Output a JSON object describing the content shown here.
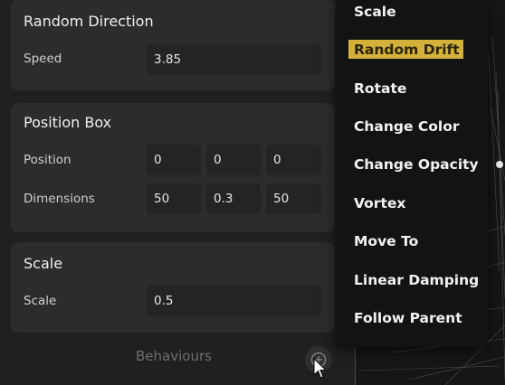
{
  "cards": {
    "random_direction": {
      "title": "Random Direction",
      "speed_label": "Speed",
      "speed_value": "3.85"
    },
    "position_box": {
      "title": "Position Box",
      "position_label": "Position",
      "position_values": [
        "0",
        "0",
        "0"
      ],
      "dimensions_label": "Dimensions",
      "dimensions_values": [
        "50",
        "0.3",
        "50"
      ]
    },
    "scale": {
      "title": "Scale",
      "scale_label": "Scale",
      "scale_value": "0.5"
    }
  },
  "footer": {
    "label": "Behaviours",
    "add_icon": "plus-circle-icon"
  },
  "menu": {
    "items": [
      "Scale",
      "Random Drift",
      "Rotate",
      "Change Color",
      "Change Opacity",
      "Vortex",
      "Move To",
      "Linear Damping",
      "Follow Parent"
    ],
    "active_index": 1,
    "highlight_color": "#d3b13a"
  },
  "colors": {
    "background": "#1b1b1b",
    "card": "#2c2c2c",
    "field": "#242424",
    "menu": "#131313"
  }
}
